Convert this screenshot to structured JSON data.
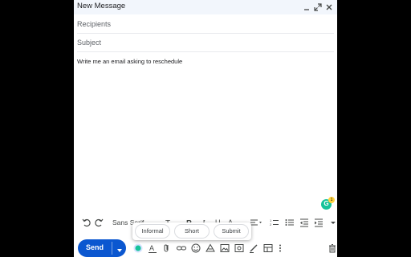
{
  "window": {
    "title": "New Message"
  },
  "fields": {
    "recipients_placeholder": "Recipients",
    "subject_placeholder": "Subject"
  },
  "body": {
    "text": "Write me an email asking to reschedule"
  },
  "grammarly": {
    "count": "1",
    "letter": "G"
  },
  "format_bar": {
    "font_name": "Sans Serif"
  },
  "suggestions": {
    "items": [
      "Informal",
      "Short",
      "Submit"
    ]
  },
  "actions": {
    "send_label": "Send"
  },
  "colors": {
    "send": "#0b57d0",
    "header": "#f2f6fc",
    "grammarly": "#15c39a"
  }
}
